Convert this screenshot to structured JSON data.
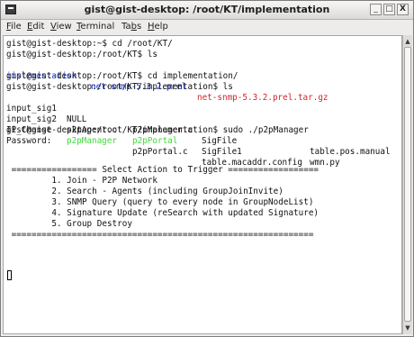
{
  "window": {
    "title": "gist@gist-desktop: /root/KT/implementation",
    "icon": "terminal-window-icon",
    "controls": {
      "minimize": "_",
      "maximize": "□",
      "close": "X"
    }
  },
  "menubar": {
    "items": [
      {
        "label_u": "F",
        "label_rest": "ile"
      },
      {
        "label_u": "E",
        "label_rest": "dit"
      },
      {
        "label_u": "V",
        "label_rest": "iew"
      },
      {
        "label_u": "T",
        "label_rest": "erminal"
      },
      {
        "label_pre": "Ta",
        "label_u": "b",
        "label_rest": "s"
      },
      {
        "label_u": "H",
        "label_rest": "elp"
      }
    ]
  },
  "terminal": {
    "lines": [
      "gist@gist-desktop:~$ cd /root/KT/",
      "gist@gist-desktop:/root/KT$ ls",
      "gist@gist-desktop:/root/KT$ cd implementation/",
      "gist@gist-desktop:/root/KT/implementation$ ls",
      "gist@gist-desktop:/root/KT/implementation$ sudo ./p2pManager",
      "Password:",
      " ================= Select Action to Trigger ==================",
      "         1. Join - P2P Network",
      "         2. Search - Agents (including GroupJoinInvite)",
      "         3. SNMP Query (query to every node in GroupNodeList)",
      "         4. Signature Update (reSearch with updated Signature)",
      "         5. Group Destroy",
      " ============================================================"
    ],
    "ls_kt": {
      "dir": "implementation",
      "dir2": "net-snmp-5.3.2.prel",
      "archive": "net-snmp-5.3.2.prel.tar.gz"
    },
    "ls_impl": {
      "row1": [
        "input_sig1",
        "NULL",
        "p2pManager.c",
        "SigFile",
        "table.pos.manual"
      ],
      "row2": [
        "input_sig2",
        "p2pAgent.c",
        "p2pPortal",
        "SigFile1",
        "wmn.py"
      ],
      "row3": [
        "IP_Change",
        "p2pManager",
        "p2pPortal.c",
        "table.macaddr.config"
      ]
    },
    "colors": {
      "directory": "#1c36d8",
      "archive": "#d0262c",
      "executable": "#3fd83a"
    }
  }
}
